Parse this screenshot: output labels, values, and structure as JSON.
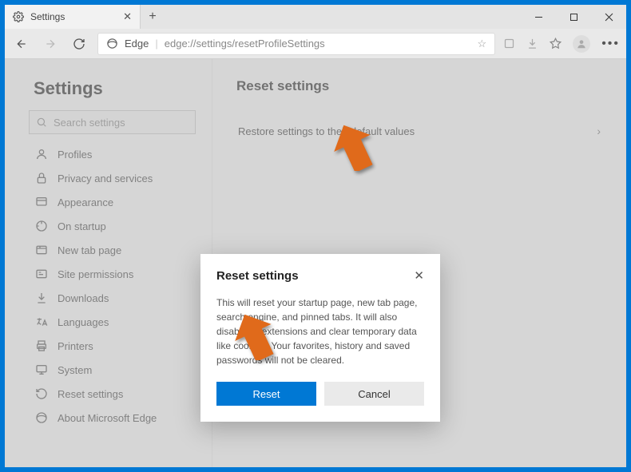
{
  "tab": {
    "title": "Settings"
  },
  "toolbar": {
    "edge_label": "Edge",
    "url": "edge://settings/resetProfileSettings"
  },
  "sidebar": {
    "title": "Settings",
    "search_placeholder": "Search settings",
    "items": [
      {
        "label": "Profiles"
      },
      {
        "label": "Privacy and services"
      },
      {
        "label": "Appearance"
      },
      {
        "label": "On startup"
      },
      {
        "label": "New tab page"
      },
      {
        "label": "Site permissions"
      },
      {
        "label": "Downloads"
      },
      {
        "label": "Languages"
      },
      {
        "label": "Printers"
      },
      {
        "label": "System"
      },
      {
        "label": "Reset settings"
      },
      {
        "label": "About Microsoft Edge"
      }
    ]
  },
  "main": {
    "title": "Reset settings",
    "row_label": "Restore settings to their default values"
  },
  "dialog": {
    "title": "Reset settings",
    "body": "This will reset your startup page, new tab page, search engine, and pinned tabs. It will also disable all extensions and clear temporary data like cookies. Your favorites, history and saved passwords will not be cleared.",
    "reset": "Reset",
    "cancel": "Cancel"
  }
}
